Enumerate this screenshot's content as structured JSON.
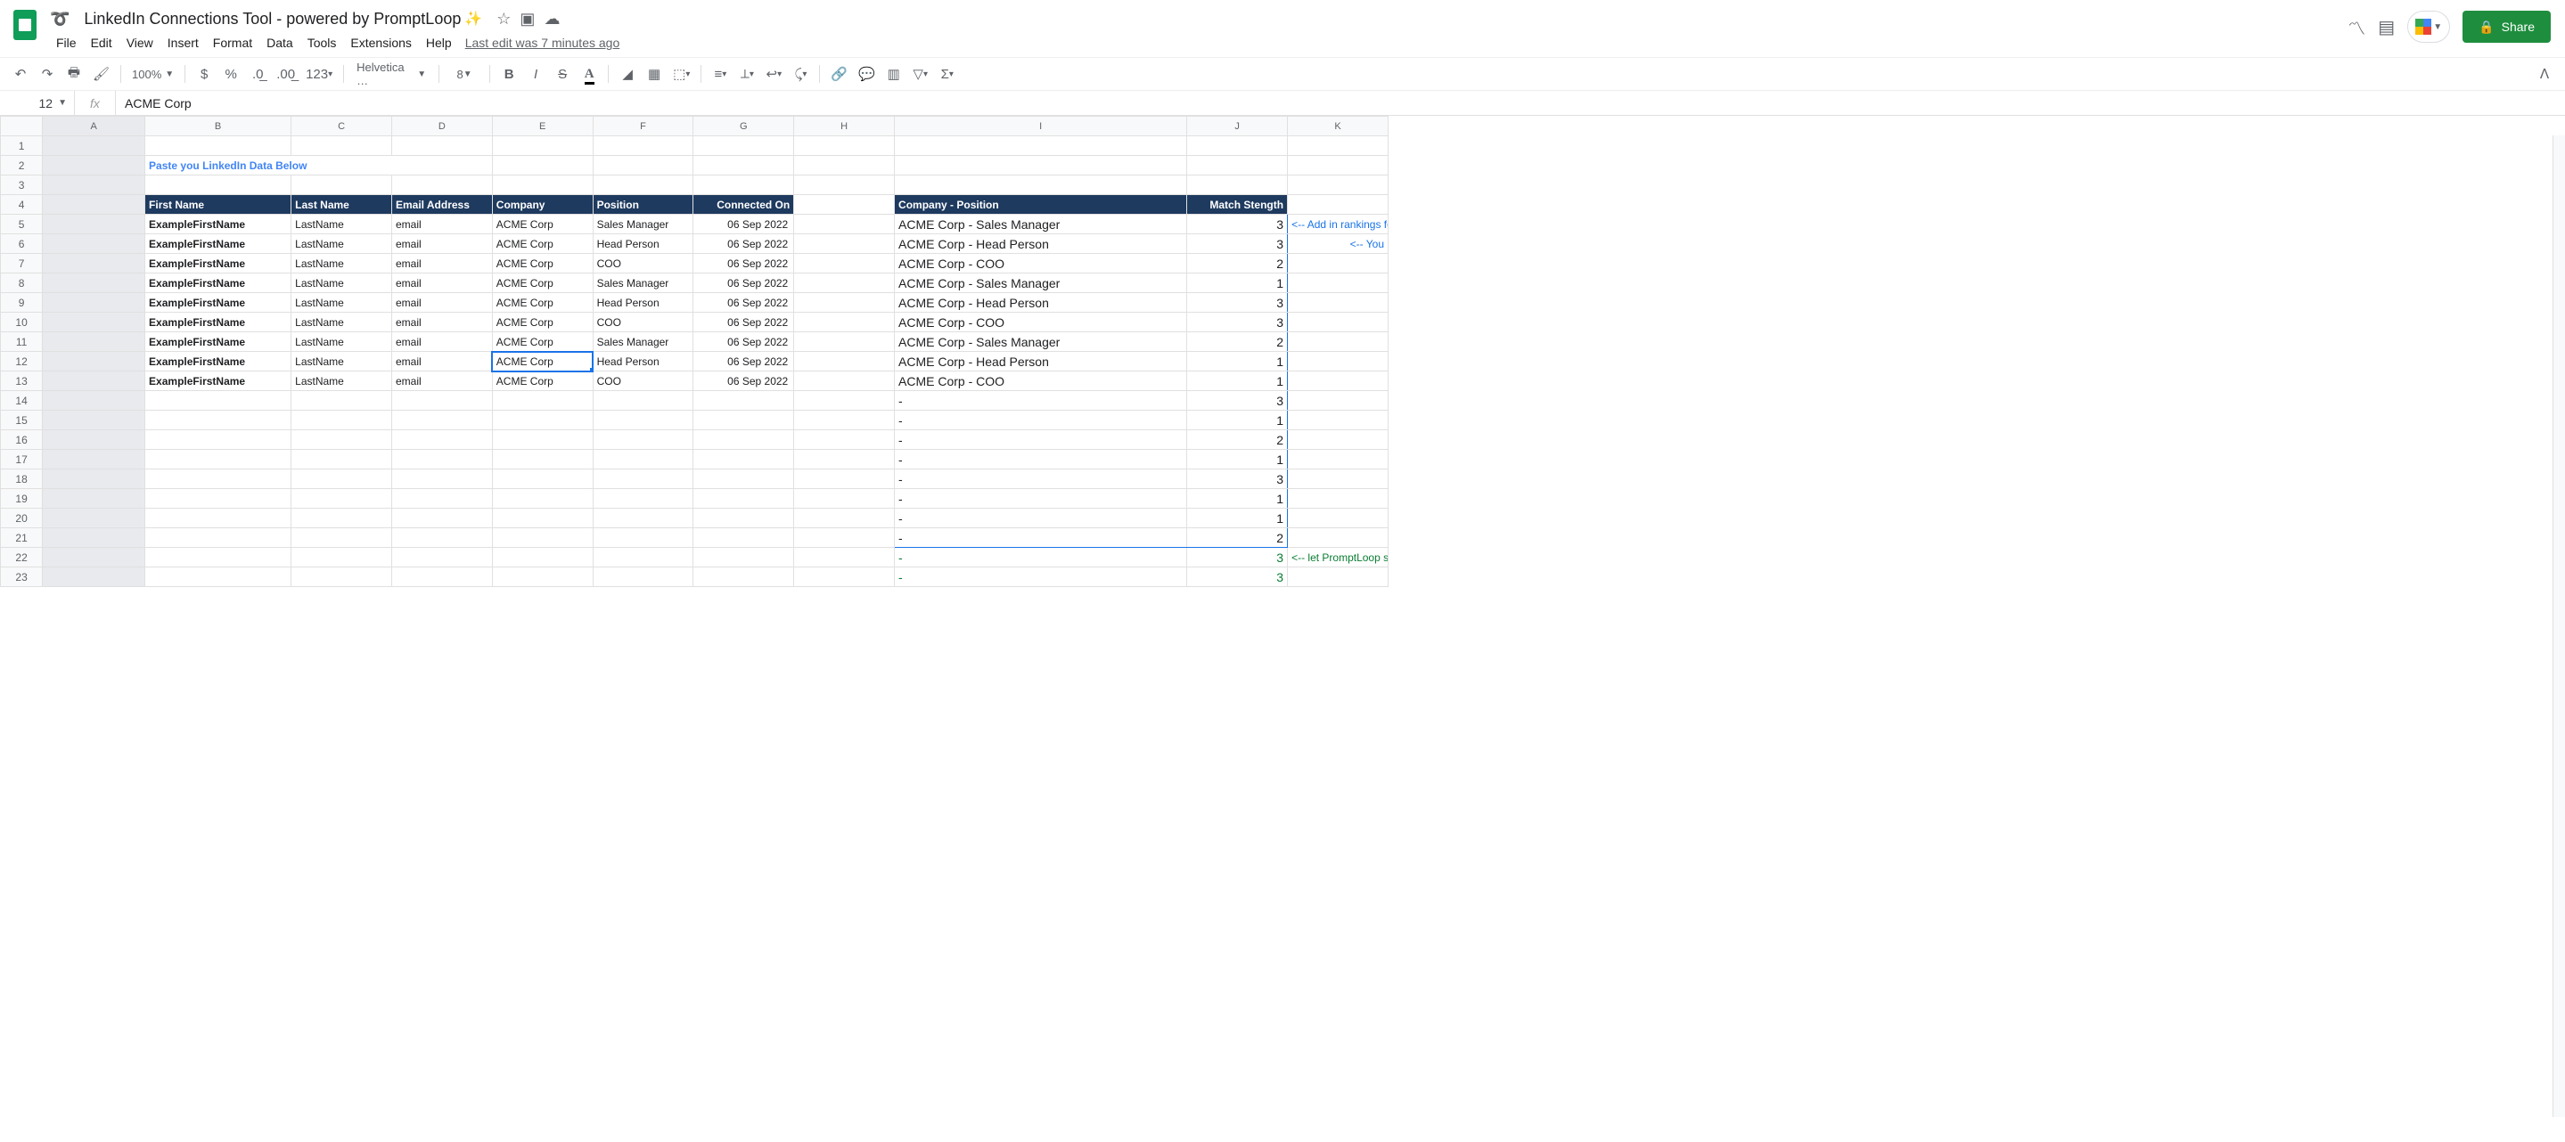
{
  "doc": {
    "title": "LinkedIn Connections Tool - powered by PromptLoop",
    "sparkles": "✨",
    "last_edit": "Last edit was 7 minutes ago",
    "share": "Share"
  },
  "menus": [
    "File",
    "Edit",
    "View",
    "Insert",
    "Format",
    "Data",
    "Tools",
    "Extensions",
    "Help"
  ],
  "toolbar": {
    "zoom": "100%",
    "font": "Helvetica …",
    "font_size": "8",
    "format_123": "123"
  },
  "namebox": "12",
  "formula": "ACME Corp",
  "columns": [
    "A",
    "B",
    "C",
    "D",
    "E",
    "F",
    "G",
    "H",
    "I",
    "J",
    "K"
  ],
  "row_numbers": [
    "1",
    "2",
    "3",
    "4",
    "5",
    "6",
    "7",
    "8",
    "9",
    "10",
    "11",
    "12",
    "13",
    "14",
    "15",
    "16",
    "17",
    "18",
    "19",
    "20",
    "21",
    "22",
    "23"
  ],
  "section_title": "Paste you LinkedIn Data Below",
  "headers": {
    "first_name": "First Name",
    "last_name": "Last Name",
    "email": "Email Address",
    "company": "Company",
    "position": "Position",
    "connected": "Connected On",
    "comp_pos": "Company - Position",
    "match": "Match Stength"
  },
  "data_rows": [
    {
      "fn": "ExampleFirstName",
      "ln": "LastName",
      "em": "email",
      "co": "ACME Corp",
      "po": "Sales Manager",
      "dt": "06 Sep 2022"
    },
    {
      "fn": "ExampleFirstName",
      "ln": "LastName",
      "em": "email",
      "co": "ACME Corp",
      "po": "Head Person",
      "dt": "06 Sep 2022"
    },
    {
      "fn": "ExampleFirstName",
      "ln": "LastName",
      "em": "email",
      "co": "ACME Corp",
      "po": "COO",
      "dt": "06 Sep 2022"
    },
    {
      "fn": "ExampleFirstName",
      "ln": "LastName",
      "em": "email",
      "co": "ACME Corp",
      "po": "Sales Manager",
      "dt": "06 Sep 2022"
    },
    {
      "fn": "ExampleFirstName",
      "ln": "LastName",
      "em": "email",
      "co": "ACME Corp",
      "po": "Head Person",
      "dt": "06 Sep 2022"
    },
    {
      "fn": "ExampleFirstName",
      "ln": "LastName",
      "em": "email",
      "co": "ACME Corp",
      "po": "COO",
      "dt": "06 Sep 2022"
    },
    {
      "fn": "ExampleFirstName",
      "ln": "LastName",
      "em": "email",
      "co": "ACME Corp",
      "po": "Sales Manager",
      "dt": "06 Sep 2022"
    },
    {
      "fn": "ExampleFirstName",
      "ln": "LastName",
      "em": "email",
      "co": "ACME Corp",
      "po": "Head Person",
      "dt": "06 Sep 2022"
    },
    {
      "fn": "ExampleFirstName",
      "ln": "LastName",
      "em": "email",
      "co": "ACME Corp",
      "po": "COO",
      "dt": "06 Sep 2022"
    }
  ],
  "right_rows": [
    {
      "cp": "ACME Corp - Sales Manager",
      "ms": "3"
    },
    {
      "cp": "ACME Corp - Head Person",
      "ms": "3"
    },
    {
      "cp": "ACME Corp - COO",
      "ms": "2"
    },
    {
      "cp": "ACME Corp - Sales Manager",
      "ms": "1"
    },
    {
      "cp": "ACME Corp - Head Person",
      "ms": "3"
    },
    {
      "cp": "ACME Corp - COO",
      "ms": "3"
    },
    {
      "cp": "ACME Corp - Sales Manager",
      "ms": "2"
    },
    {
      "cp": "ACME Corp - Head Person",
      "ms": "1"
    },
    {
      "cp": "ACME Corp - COO",
      "ms": "1"
    },
    {
      "cp": " - ",
      "ms": "3"
    },
    {
      "cp": " - ",
      "ms": "1"
    },
    {
      "cp": " - ",
      "ms": "2"
    },
    {
      "cp": " - ",
      "ms": "1"
    },
    {
      "cp": " - ",
      "ms": "3"
    },
    {
      "cp": " - ",
      "ms": "1"
    },
    {
      "cp": " - ",
      "ms": "1"
    },
    {
      "cp": " - ",
      "ms": "2"
    }
  ],
  "green_rows": [
    {
      "cp": " - ",
      "ms": "3"
    },
    {
      "cp": " - ",
      "ms": "3"
    }
  ],
  "annotations": {
    "row5": "<-- Add in rankings for th",
    "row6": "<-- You",
    "row22": "<-- let PromptLoop solve"
  }
}
